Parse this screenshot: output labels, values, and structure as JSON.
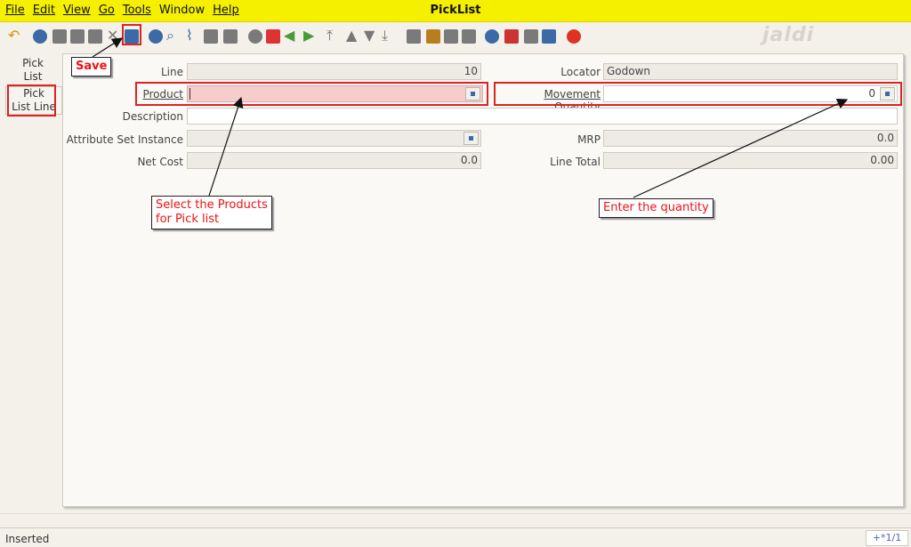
{
  "window": {
    "title": "PickList"
  },
  "menu": [
    {
      "id": "file",
      "label": "File"
    },
    {
      "id": "edit",
      "label": "Edit"
    },
    {
      "id": "view",
      "label": "View"
    },
    {
      "id": "go",
      "label": "Go"
    },
    {
      "id": "tools",
      "label": "Tools"
    },
    {
      "id": "window",
      "label": "Window"
    },
    {
      "id": "help",
      "label": "Help"
    }
  ],
  "watermark": "jaldi",
  "tabs": [
    {
      "label_1": "Pick",
      "label_2": "List"
    },
    {
      "label_1": "Pick",
      "label_2": "List Line"
    }
  ],
  "form": {
    "line": {
      "label": "Line",
      "value": "10"
    },
    "locator": {
      "label": "Locator",
      "value": "Godown"
    },
    "product": {
      "label": "Product",
      "value": ""
    },
    "movement_quantity": {
      "label": "Movement Quantity",
      "value": "0"
    },
    "description": {
      "label": "Description",
      "value": ""
    },
    "attribute_set_instance": {
      "label": "Attribute Set Instance",
      "value": ""
    },
    "mrp": {
      "label": "MRP",
      "value": "0.0"
    },
    "net_cost": {
      "label": "Net Cost",
      "value": "0.0"
    },
    "line_total": {
      "label": "Line Total",
      "value": "0.00"
    }
  },
  "annotations": {
    "save": "Save",
    "products_1": "Select the Products",
    "products_2": "for Pick list",
    "quantity": "Enter the quantity"
  },
  "status": {
    "text": "Inserted",
    "record": "+*1/1"
  },
  "colors": {
    "titlebar": "#f5f000",
    "highlight": "#dd2222",
    "mandatory": "#f7cccc"
  }
}
